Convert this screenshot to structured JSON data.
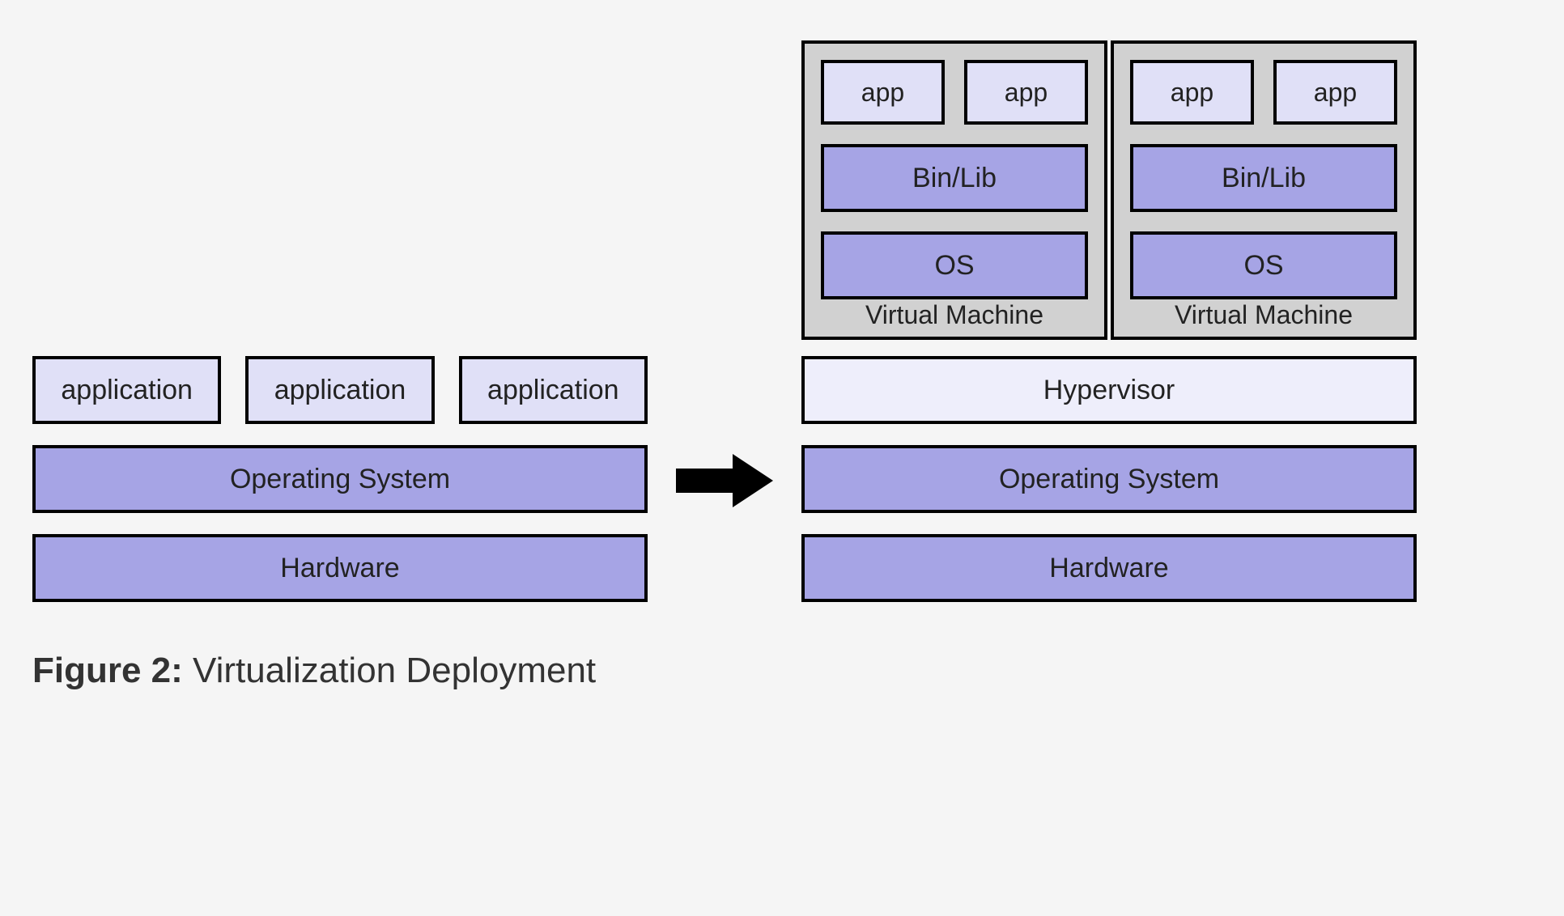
{
  "left": {
    "apps": [
      "application",
      "application",
      "application"
    ],
    "os": "Operating System",
    "hardware": "Hardware"
  },
  "right": {
    "vms": [
      {
        "apps": [
          "app",
          "app"
        ],
        "binlib": "Bin/Lib",
        "os": "OS",
        "label": "Virtual Machine"
      },
      {
        "apps": [
          "app",
          "app"
        ],
        "binlib": "Bin/Lib",
        "os": "OS",
        "label": "Virtual Machine"
      }
    ],
    "hypervisor": "Hypervisor",
    "os": "Operating System",
    "hardware": "Hardware"
  },
  "caption": {
    "prefix": "Figure 2:",
    "text": " Virtualization Deployment"
  }
}
